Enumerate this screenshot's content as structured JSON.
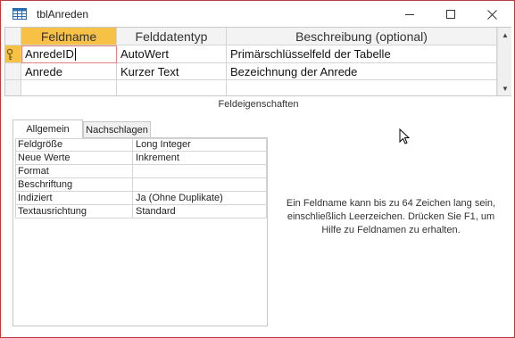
{
  "window": {
    "title": "tblAnreden",
    "minimize_icon": "minimize-icon",
    "maximize_icon": "maximize-icon",
    "close_icon": "close-icon"
  },
  "grid": {
    "columns": [
      "Feldname",
      "Felddatentyp",
      "Beschreibung (optional)"
    ],
    "rows": [
      {
        "name": "AnredeID",
        "type": "AutoWert",
        "description": "Primärschlüsselfeld der Tabelle",
        "primary_key": true
      },
      {
        "name": "Anrede",
        "type": "Kurzer Text",
        "description": "Bezeichnung der Anrede",
        "primary_key": false
      },
      {
        "name": "",
        "type": "",
        "description": "",
        "primary_key": false
      }
    ],
    "selected_column": "Feldname",
    "key_icon": "primary-key-icon"
  },
  "properties": {
    "section_label": "Feldeigenschaften",
    "tabs": [
      "Allgemein",
      "Nachschlagen"
    ],
    "active_tab": "Allgemein",
    "rows": [
      {
        "name": "Feldgröße",
        "value": "Long Integer"
      },
      {
        "name": "Neue Werte",
        "value": "Inkrement"
      },
      {
        "name": "Format",
        "value": ""
      },
      {
        "name": "Beschriftung",
        "value": ""
      },
      {
        "name": "Indiziert",
        "value": "Ja (Ohne Duplikate)"
      },
      {
        "name": "Textausrichtung",
        "value": "Standard"
      }
    ],
    "help_text": "Ein Feldname kann bis zu 64 Zeichen lang sein, einschließlich Leerzeichen. Drücken Sie F1, um Hilfe zu Feldnamen zu erhalten."
  },
  "colors": {
    "accent_selected": "#f7c146",
    "border_frame": "#b83c3c",
    "grid_line": "#d4d4d4"
  }
}
